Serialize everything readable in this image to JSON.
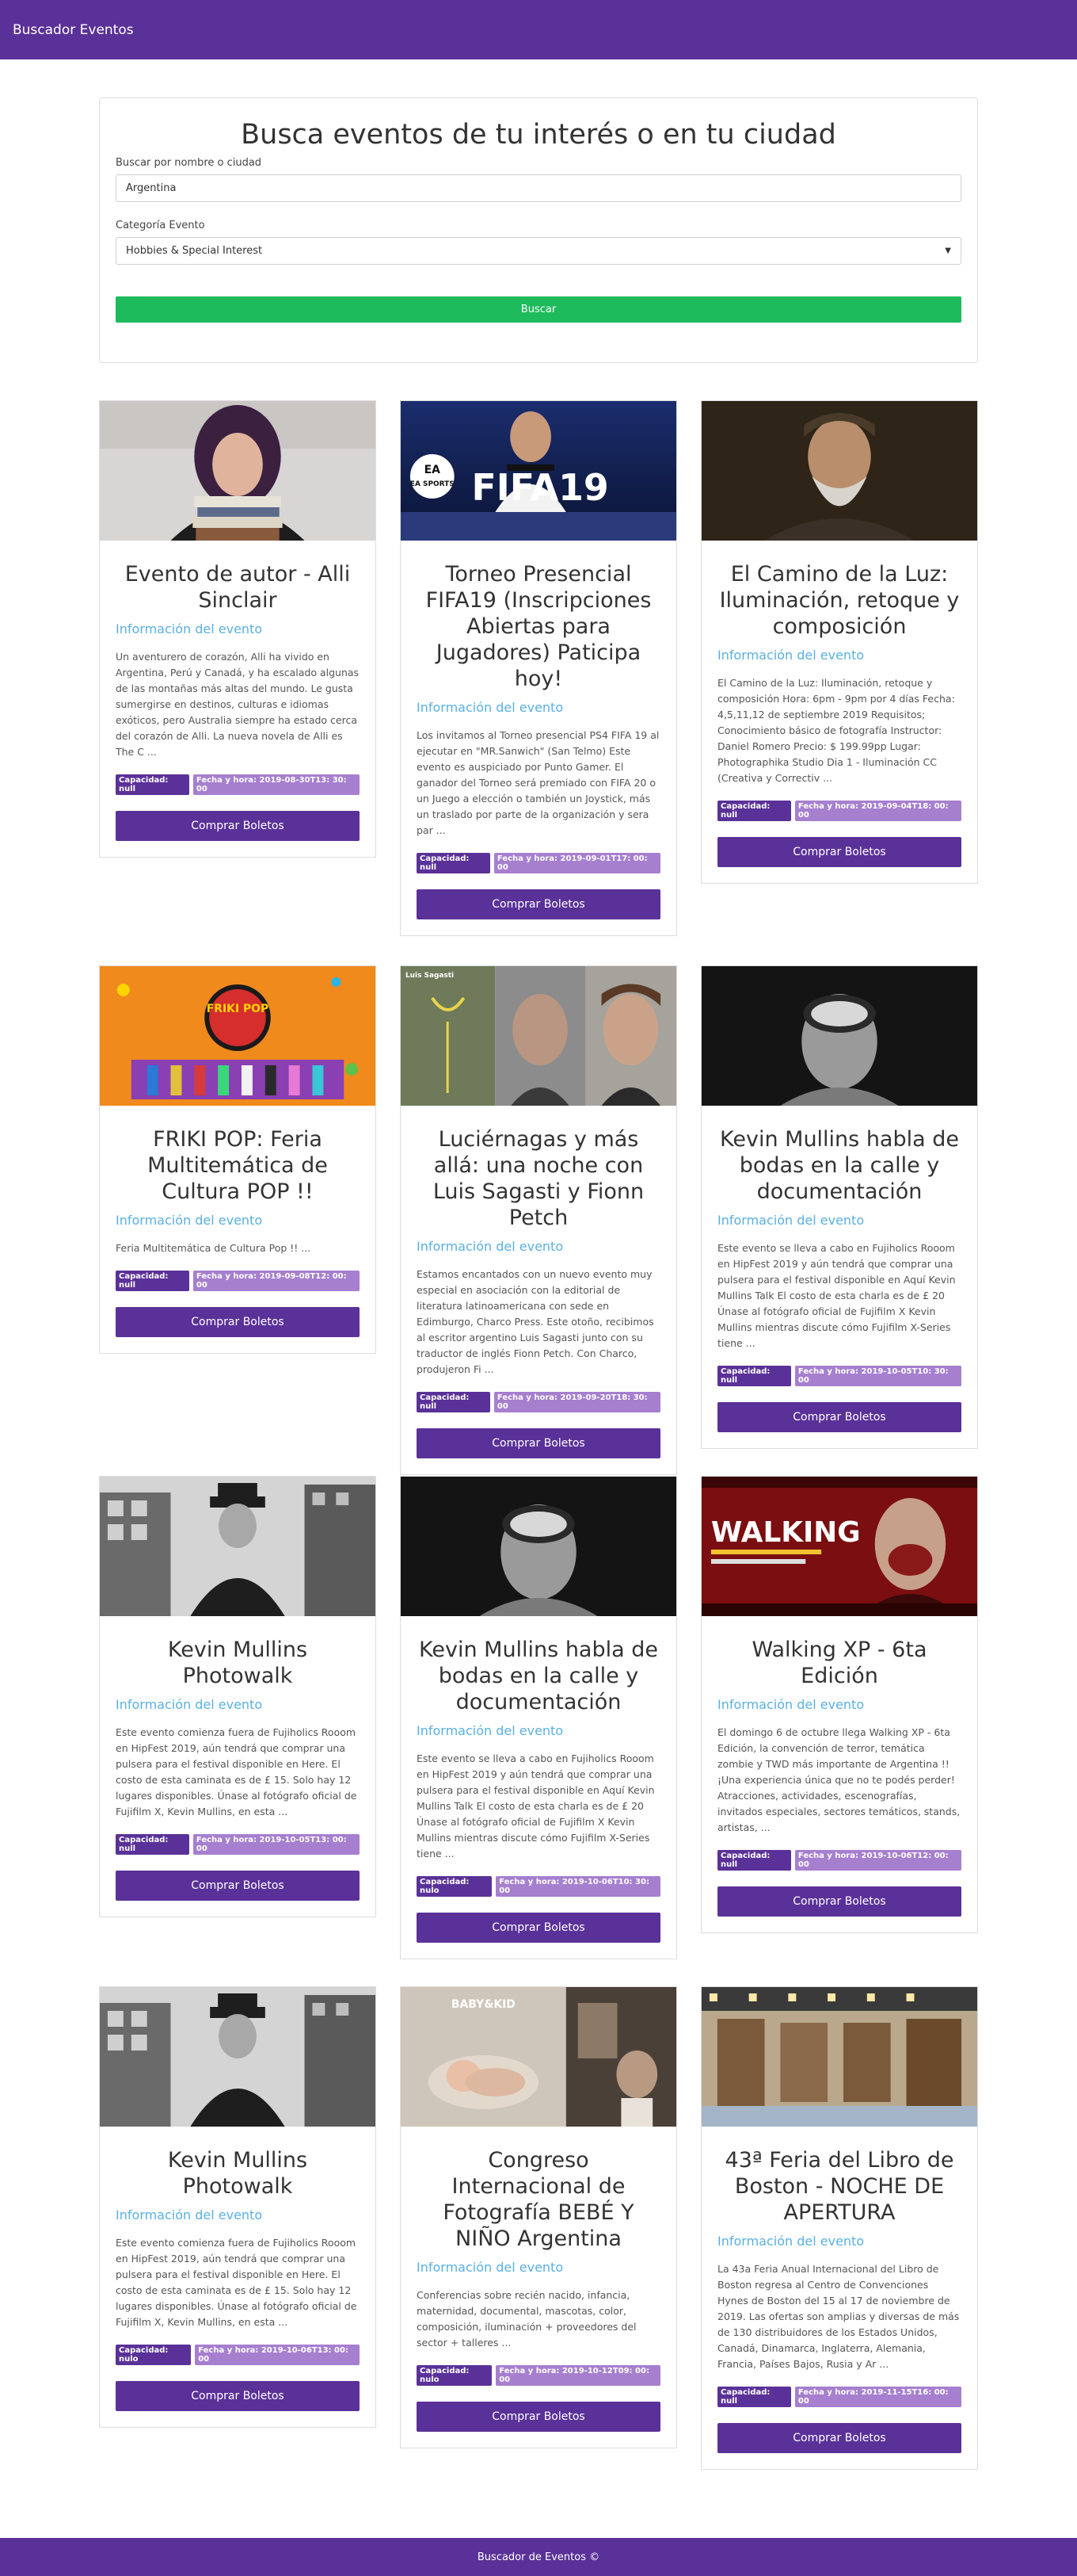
{
  "navbar": {
    "brand": "Buscador Eventos"
  },
  "search": {
    "heading": "Busca eventos de tu interés o en tu ciudad",
    "name_label": "Buscar por nombre o ciudad",
    "name_value": "Argentina",
    "category_label": "Categoría Evento",
    "category_value": "Hobbies & Special Interest",
    "button": "Buscar"
  },
  "info_label": "Información del evento",
  "buy_label": "Comprar Boletos",
  "events": [
    {
      "title": "Evento de autor - Alli Sinclair",
      "description": "Un aventurero de corazón, Alli ha vivido en Argentina, Perú y Canadá, y ha escalado algunas de las montañas más altas del mundo. Le gusta sumergirse en destinos, culturas e idiomas exóticos, pero Australia siempre ha estado cerca del corazón de Alli. La nueva novela de Alli es The C ...",
      "capacity": "Capacidad: null",
      "datetime": "Fecha y hora: 2019-08-30T13: 30: 00"
    },
    {
      "title": "Torneo Presencial FIFA19 (Inscripciones Abiertas para Jugadores) Paticipa hoy!",
      "description": "Los invitamos al Torneo presencial PS4 FIFA 19 al ejecutar en \"MR.Sanwich\" (San Telmo) Este evento es auspiciado por Punto Gamer. El ganador del Torneo será premiado con FIFA 20 o un Juego a elección o también un Joystick, más un traslado por parte de la organización y sera par ...",
      "capacity": "Capacidad: null",
      "datetime": "Fecha y hora: 2019-09-01T17: 00: 00"
    },
    {
      "title": "El Camino de la Luz: Iluminación, retoque y composición",
      "description": "El Camino de la Luz: Iluminación, retoque y composición Hora: 6pm - 9pm por 4 días Fecha: 4,5,11,12 de septiembre 2019 Requisitos; Conocimiento básico de fotografía Instructor: Daniel Romero Precio: $ 199.99pp Lugar: Photographika Studio Dia 1 - Iluminación CC (Creativa y Correctiv ...",
      "capacity": "Capacidad: null",
      "datetime": "Fecha y hora: 2019-09-04T18: 00: 00"
    },
    {
      "title": "FRIKI POP: Feria Multitemática de Cultura POP !!",
      "description": "Feria Multitemática de Cultura Pop !! ...",
      "capacity": "Capacidad: null",
      "datetime": "Fecha y hora: 2019-09-08T12: 00: 00"
    },
    {
      "title": "Luciérnagas y más allá: una noche con Luis Sagasti y Fionn Petch",
      "description": "Estamos encantados con un nuevo evento muy especial en asociación con la editorial de literatura latinoamericana con sede en Edimburgo, Charco Press. Este otoño, recibimos al escritor argentino Luis Sagasti junto con su traductor de inglés Fionn Petch. Con Charco, produjeron Fi ...",
      "capacity": "Capacidad: null",
      "datetime": "Fecha y hora: 2019-09-20T18: 30: 00"
    },
    {
      "title": "Kevin Mullins habla de bodas en la calle y documentación",
      "description": "Este evento se lleva a cabo en Fujiholics Rooom en HipFest 2019 y aún tendrá que comprar una pulsera para el festival disponible en Aquí Kevin Mullins Talk El costo de esta charla es de £ 20 Únase al fotógrafo oficial de Fujifilm X Kevin Mullins mientras discute cómo Fujifilm X-Series tiene ...",
      "capacity": "Capacidad: null",
      "datetime": "Fecha y hora: 2019-10-05T10: 30: 00"
    },
    {
      "title": "Kevin Mullins Photowalk",
      "description": "Este evento comienza fuera de Fujiholics Rooom en HipFest 2019, aún tendrá que comprar una pulsera para el festival disponible en Here. El costo de esta caminata es de £ 15. Solo hay 12 lugares disponibles. Únase al fotógrafo oficial de Fujifilm X, Kevin Mullins, en esta ...",
      "capacity": "Capacidad: null",
      "datetime": "Fecha y hora: 2019-10-05T13: 00: 00"
    },
    {
      "title": "Kevin Mullins habla de bodas en la calle y documentación",
      "description": "Este evento se lleva a cabo en Fujiholics Rooom en HipFest 2019 y aún tendrá que comprar una pulsera para el festival disponible en Aquí Kevin Mullins Talk El costo de esta charla es de £ 20 Únase al fotógrafo oficial de Fujifilm X Kevin Mullins mientras discute cómo Fujifilm X-Series tiene ...",
      "capacity": "Capacidad: nulo",
      "datetime": "Fecha y hora: 2019-10-06T10: 30: 00"
    },
    {
      "title": "Walking XP - 6ta Edición",
      "description": "El domingo 6 de octubre llega Walking XP - 6ta Edición, la convención de terror, temática zombie y TWD más importante de Argentina !! ¡Una experiencia única que no te podés perder! Atracciones, actividades, escenografías, invitados especiales, sectores temáticos, stands, artistas, ...",
      "capacity": "Capacidad: null",
      "datetime": "Fecha y hora: 2019-10-06T12: 00: 00"
    },
    {
      "title": "Kevin Mullins Photowalk",
      "description": "Este evento comienza fuera de Fujiholics Rooom en HipFest 2019, aún tendrá que comprar una pulsera para el festival disponible en Here. El costo de esta caminata es de £ 15. Solo hay 12 lugares disponibles. Únase al fotógrafo oficial de Fujifilm X, Kevin Mullins, en esta ...",
      "capacity": "Capacidad: nulo",
      "datetime": "Fecha y hora: 2019-10-06T13: 00: 00"
    },
    {
      "title": "Congreso Internacional de Fotografía BEBÉ Y NIÑO Argentina",
      "description": "Conferencias sobre recién nacido, infancia, maternidad, documental, mascotas, color, composición, iluminación + proveedores del sector + talleres ...",
      "capacity": "Capacidad: nulo",
      "datetime": "Fecha y hora: 2019-10-12T09: 00: 00"
    },
    {
      "title": "43ª Feria del Libro de Boston - NOCHE DE APERTURA",
      "description": "La 43a Feria Anual Internacional del Libro de Boston regresa al Centro de Convenciones Hynes de Boston del 15 al 17 de noviembre de 2019. Las ofertas son amplias y diversas de más de 130 distribuidores de los Estados Unidos, Canadá, Dinamarca, Inglaterra, Alemania, Francia, Países Bajos, Rusia y Ar ...",
      "capacity": "Capacidad: null",
      "datetime": "Fecha y hora: 2019-11-15T16: 00: 00"
    }
  ],
  "image_text": {
    "fifa": "FIFA19",
    "ea": "EA SPORTS",
    "friki": "FRIKI POP",
    "luis": "Luis Sagasti",
    "walking": "WALKING",
    "baby": "BABY&KID"
  },
  "footer": {
    "text": "Buscador de Eventos ©"
  }
}
